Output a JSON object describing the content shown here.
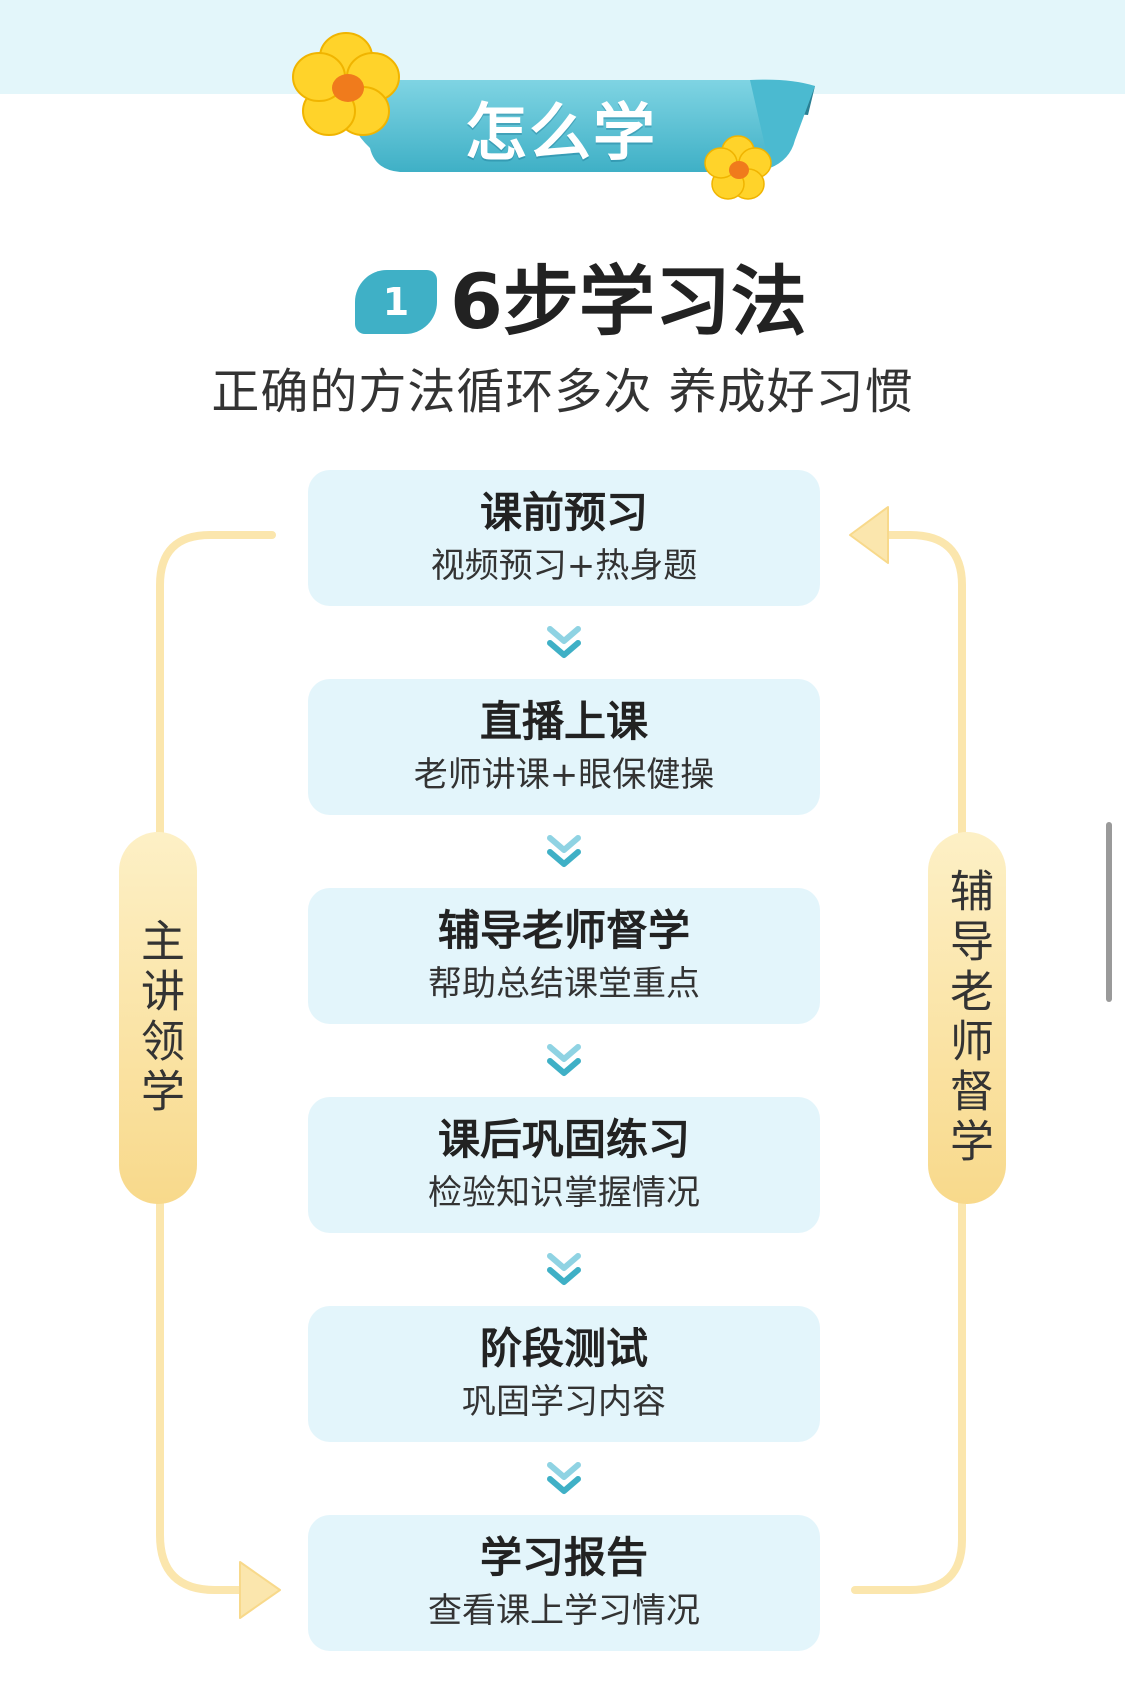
{
  "header": {
    "ribbon_label": "怎么学",
    "accent_color": "#3fb0c6"
  },
  "section": {
    "number": "1",
    "title": "6步学习法",
    "subtitle": "正确的方法循环多次 养成好习惯"
  },
  "steps": [
    {
      "title": "课前预习",
      "desc": "视频预习+热身题"
    },
    {
      "title": "直播上课",
      "desc": "老师讲课+眼保健操"
    },
    {
      "title": "辅导老师督学",
      "desc": "帮助总结课堂重点"
    },
    {
      "title": "课后巩固练习",
      "desc": "检验知识掌握情况"
    },
    {
      "title": "阶段测试",
      "desc": "巩固学习内容"
    },
    {
      "title": "学习报告",
      "desc": "查看课上学习情况"
    }
  ],
  "side_labels": {
    "left": "主讲领学",
    "right": "辅导老师督学"
  },
  "icons": {
    "flower": "flower-icon",
    "chevron": "double-chevron-down-icon",
    "arrow": "arrow-icon"
  }
}
